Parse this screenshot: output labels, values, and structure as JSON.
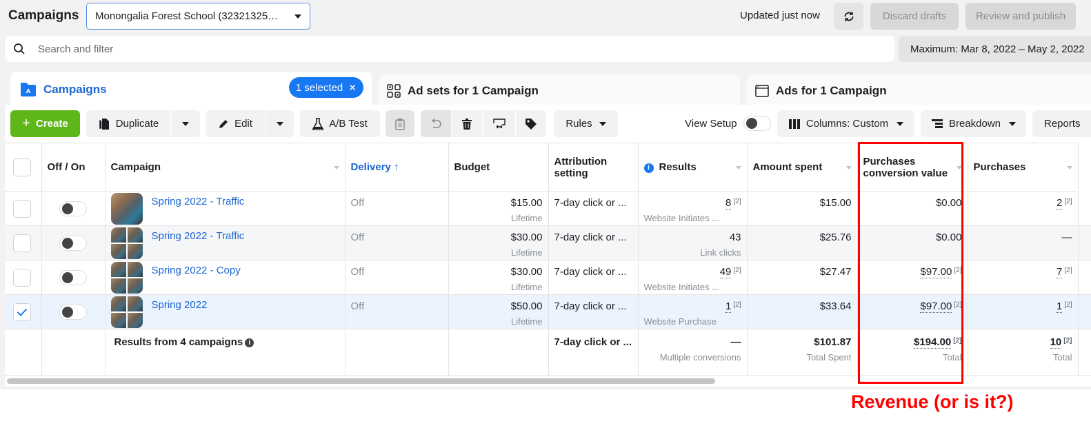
{
  "header": {
    "title": "Campaigns",
    "account_selector": "Monongalia Forest School (32321325…",
    "status": "Updated just now",
    "discard_label": "Discard drafts",
    "review_label": "Review and publish"
  },
  "search": {
    "placeholder": "Search and filter",
    "value": "",
    "date_range": "Maximum: Mar 8, 2022 – May 2, 2022"
  },
  "tabs": [
    {
      "label": "Campaigns",
      "icon": "folder-icon",
      "active": true,
      "badge": "1 selected"
    },
    {
      "label": "Ad sets for 1 Campaign",
      "icon": "grid-icon",
      "active": false
    },
    {
      "label": "Ads for 1 Campaign",
      "icon": "window-icon",
      "active": false
    }
  ],
  "toolbar": {
    "create_label": "Create",
    "duplicate_label": "Duplicate",
    "edit_label": "Edit",
    "ab_test_label": "A/B Test",
    "rules_label": "Rules",
    "view_setup_label": "View Setup",
    "view_setup_on": false,
    "columns_label": "Columns: Custom",
    "breakdown_label": "Breakdown",
    "reports_label": "Reports"
  },
  "table": {
    "columns": [
      "Off / On",
      "Campaign",
      "Delivery ↑",
      "Budget",
      "Attribution setting",
      "Results",
      "Amount spent",
      "Purchases conversion value",
      "Purchases"
    ],
    "rows": [
      {
        "selected": false,
        "on": false,
        "thumb": "single",
        "name": "Spring 2022 - Traffic",
        "delivery": "Off",
        "budget": "$15.00",
        "budget_type": "Lifetime",
        "attribution": "7-day click or ...",
        "results": "8",
        "results_ref": "[2]",
        "results_type": "Website Initiates ...",
        "amount_spent": "$15.00",
        "conv_value": "$0.00",
        "conv_value_ref": "",
        "purchases": "2",
        "purchases_ref": "[2]"
      },
      {
        "selected": false,
        "on": false,
        "thumb": "grid",
        "name": "Spring 2022 - Traffic",
        "delivery": "Off",
        "budget": "$30.00",
        "budget_type": "Lifetime",
        "attribution": "7-day click or ...",
        "results": "43",
        "results_ref": "",
        "results_type": "Link clicks",
        "amount_spent": "$25.76",
        "conv_value": "$0.00",
        "conv_value_ref": "",
        "purchases": "—",
        "purchases_ref": ""
      },
      {
        "selected": false,
        "on": false,
        "thumb": "grid",
        "name": "Spring 2022 - Copy",
        "delivery": "Off",
        "budget": "$30.00",
        "budget_type": "Lifetime",
        "attribution": "7-day click or ...",
        "results": "49",
        "results_ref": "[2]",
        "results_type": "Website Initiates ...",
        "amount_spent": "$27.47",
        "conv_value": "$97.00",
        "conv_value_ref": "[2]",
        "purchases": "7",
        "purchases_ref": "[2]"
      },
      {
        "selected": true,
        "on": false,
        "thumb": "grid",
        "name": "Spring 2022",
        "delivery": "Off",
        "budget": "$50.00",
        "budget_type": "Lifetime",
        "attribution": "7-day click or ...",
        "results": "1",
        "results_ref": "[2]",
        "results_type": "Website Purchase",
        "amount_spent": "$33.64",
        "conv_value": "$97.00",
        "conv_value_ref": "[2]",
        "purchases": "1",
        "purchases_ref": "[2]"
      }
    ],
    "summary": {
      "label": "Results from 4 campaigns",
      "attribution": "7-day click or ...",
      "results": "—",
      "results_type": "Multiple conversions",
      "amount_spent": "$101.87",
      "amount_spent_label": "Total Spent",
      "conv_value": "$194.00",
      "conv_value_ref": "[2]",
      "conv_value_label": "Total",
      "purchases": "10",
      "purchases_ref": "[2]",
      "purchases_label": "Total"
    }
  },
  "annotation": {
    "text": "Revenue (or is it?)",
    "color": "#ff0000"
  },
  "colors": {
    "accent": "#1877f2",
    "link": "#1b66d2",
    "create": "#5fb619"
  }
}
